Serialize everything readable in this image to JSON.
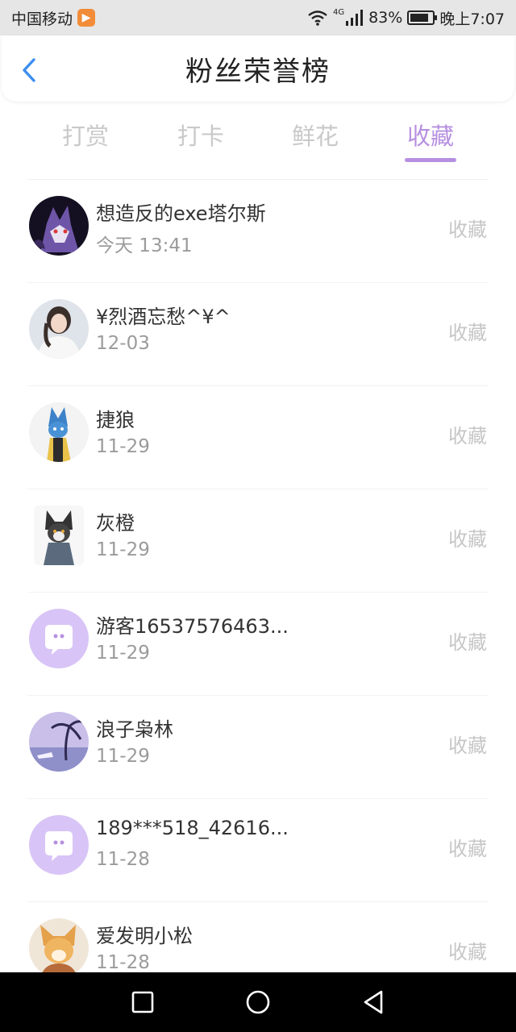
{
  "status_bar": {
    "carrier": "中国移动",
    "network": "4G",
    "battery": "83%",
    "battery_level": 0.83,
    "time": "晚上7:07"
  },
  "header": {
    "title": "粉丝荣誉榜"
  },
  "tabs": [
    {
      "label": "打赏",
      "active": false
    },
    {
      "label": "打卡",
      "active": false
    },
    {
      "label": "鲜花",
      "active": false
    },
    {
      "label": "收藏",
      "active": true
    }
  ],
  "colors": {
    "accent": "#b690e0",
    "muted": "#c6c6c6",
    "default_avatar": "#d8c4f6"
  },
  "fans": [
    {
      "name": "想造反的exe塔尔斯",
      "time": "今天 13:41",
      "action": "收藏",
      "avatar": "wolf-avatar-icon"
    },
    {
      "name": "¥烈酒忘愁^¥^",
      "time": "12-03",
      "action": "收藏",
      "avatar": "person-avatar-icon"
    },
    {
      "name": "捷狼",
      "time": "11-29",
      "action": "收藏",
      "avatar": "wolf-avatar-icon"
    },
    {
      "name": "灰橙",
      "time": "11-29",
      "action": "收藏",
      "avatar": "wolf-avatar-icon"
    },
    {
      "name": "游客16537576463...",
      "time": "11-29",
      "action": "收藏",
      "avatar": "default-chat-avatar-icon"
    },
    {
      "name": "浪子枭林",
      "time": "11-29",
      "action": "收藏",
      "avatar": "palm-tree-avatar-icon"
    },
    {
      "name": "189***518_42616...",
      "time": "11-28",
      "action": "收藏",
      "avatar": "default-chat-avatar-icon"
    },
    {
      "name": "爱发明小松",
      "time": "11-28",
      "action": "收藏",
      "avatar": "fox-avatar-icon"
    }
  ]
}
